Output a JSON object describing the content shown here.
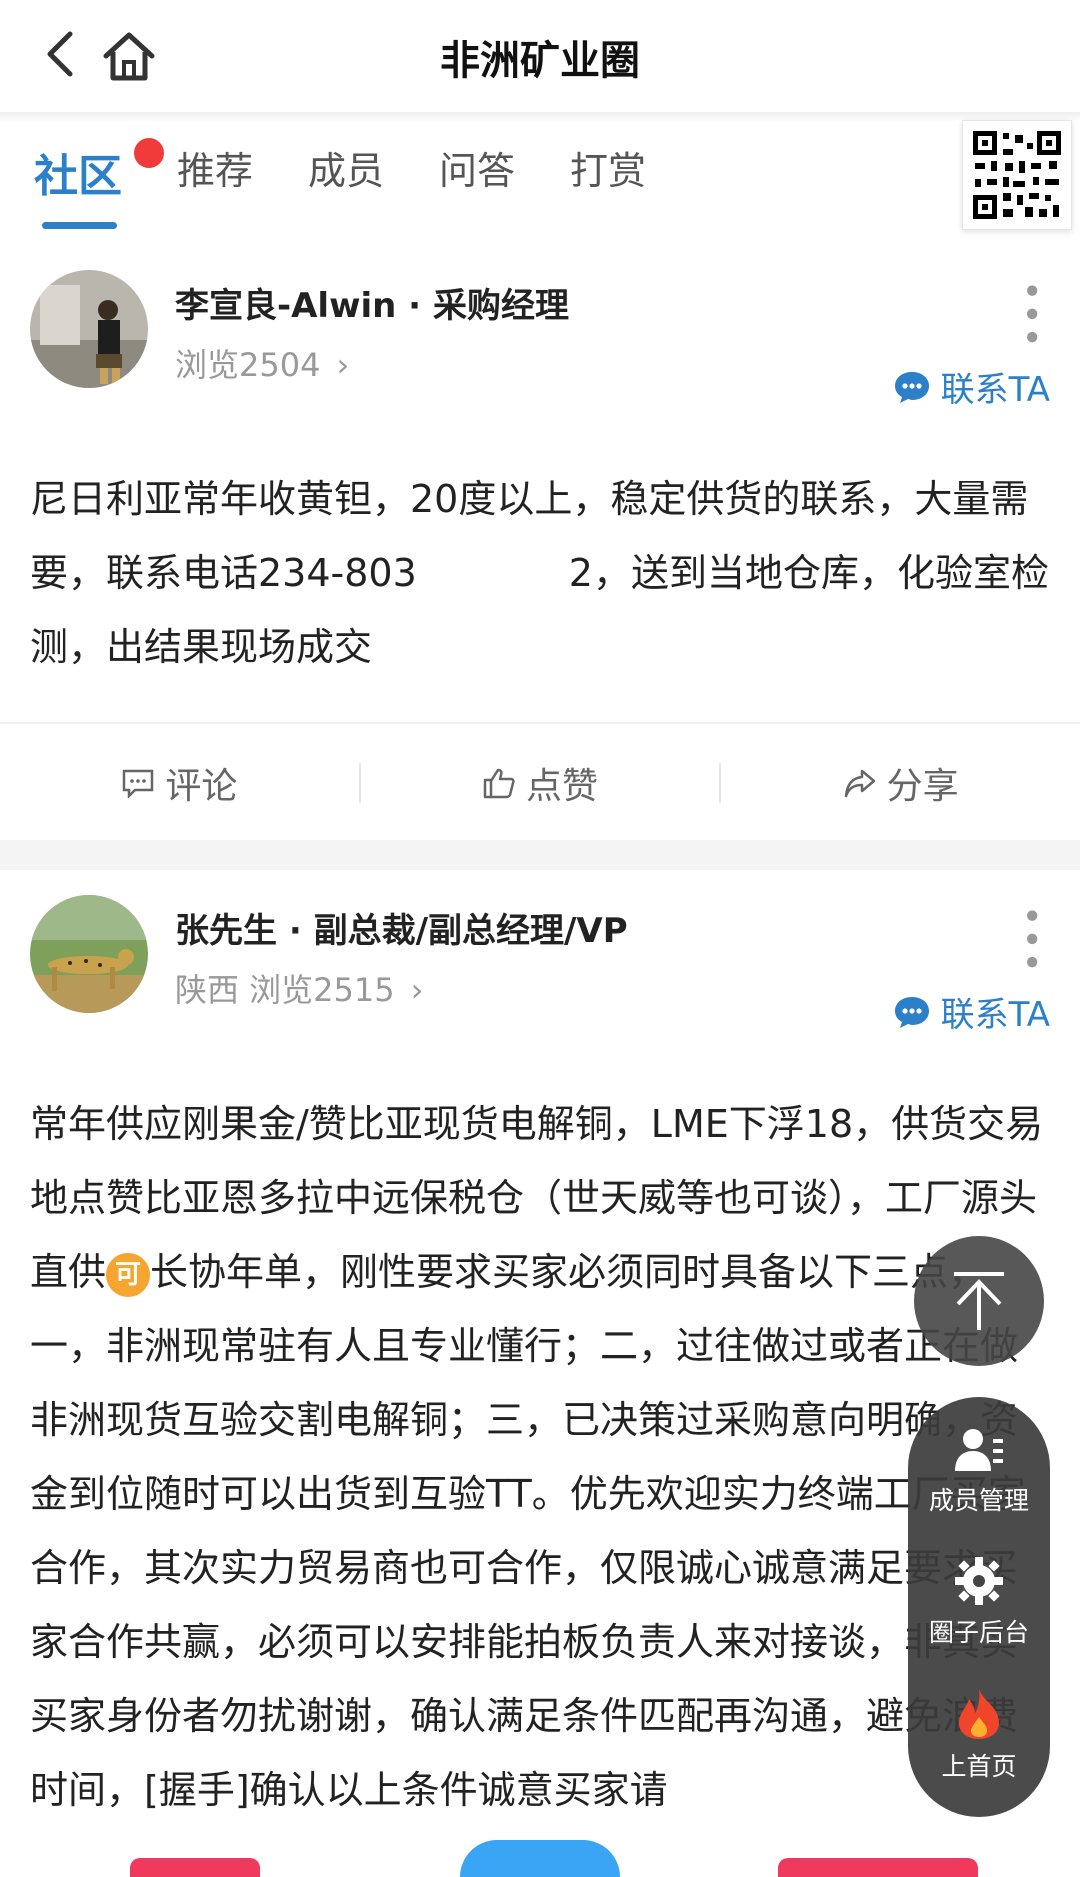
{
  "header": {
    "title": "非洲矿业圈"
  },
  "tabs": [
    {
      "label": "社区",
      "active": true
    },
    {
      "label": "推荐"
    },
    {
      "label": "成员"
    },
    {
      "label": "问答"
    },
    {
      "label": "打赏"
    }
  ],
  "posts": [
    {
      "author": "李宣良-Alwin · 采购经理",
      "meta": "浏览2504",
      "contact_label": "联系TA",
      "content": "尼日利亚常年收黄钽，20度以上，稳定供货的联系，大量需要，联系电话234-803　　　　2，送到当地仓库，化验室检测，出结果现场成交",
      "actions": {
        "comment": "评论",
        "like": "点赞",
        "share": "分享"
      }
    },
    {
      "author": "张先生 · 副总裁/副总经理/VP",
      "meta": "陕西  浏览2515",
      "contact_label": "联系TA",
      "content_before_coin": "常年供应刚果金/赞比亚现货电解铜，LME下浮18，供货交易地点赞比亚恩多拉中远保税仓（世天威等也可谈），工厂源头直供",
      "coin_label": "可",
      "content_after_coin": "长协年单，刚性要求买家必须同时具备以下三点，一，非洲现常驻有人且专业懂行；二，过往做过或者正在做非洲现货互验交割电解铜；三，已决策过采购意向明确，资金到位随时可以出货到互验TT。优先欢迎实力终端工厂买家合作，其次实力贸易商也可合作，仅限诚心诚意满足要求买家合作共赢，必须可以安排能拍板负责人来对接谈，非真实买家身份者勿扰谢谢，确认满足条件匹配再沟通，避免浪费时间，[握手]确认以上条件诚意买家请"
    }
  ],
  "floating": {
    "member_manage": "成员管理",
    "circle_admin": "圈子后台",
    "to_homepage": "上首页"
  },
  "colors": {
    "accent": "#2c7fc9",
    "badge": "#f13a3a",
    "coin": "#f6a531"
  }
}
